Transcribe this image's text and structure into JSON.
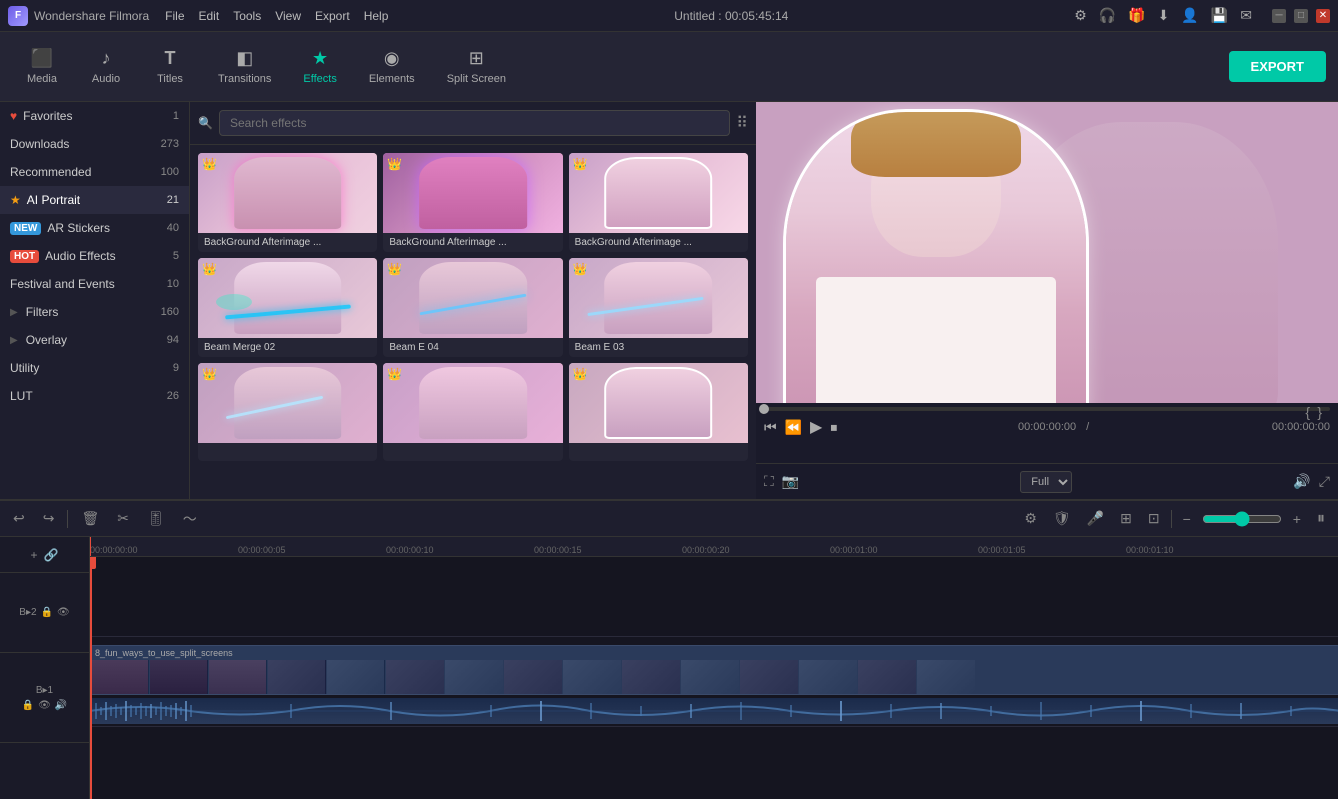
{
  "app": {
    "name": "Wondershare Filmora",
    "title": "Untitled : 00:05:45:14"
  },
  "titlebar": {
    "menus": [
      "File",
      "Edit",
      "Tools",
      "View",
      "Export",
      "Help"
    ],
    "win_controls": [
      "─",
      "□",
      "✕"
    ]
  },
  "toolbar": {
    "items": [
      {
        "id": "media",
        "label": "Media",
        "icon": "⬛"
      },
      {
        "id": "audio",
        "label": "Audio",
        "icon": "♪"
      },
      {
        "id": "titles",
        "label": "Titles",
        "icon": "T"
      },
      {
        "id": "transitions",
        "label": "Transitions",
        "icon": "◧"
      },
      {
        "id": "effects",
        "label": "Effects",
        "icon": "★"
      },
      {
        "id": "elements",
        "label": "Elements",
        "icon": "◉"
      },
      {
        "id": "splitscreen",
        "label": "Split Screen",
        "icon": "⊞"
      }
    ],
    "export_label": "EXPORT"
  },
  "sidebar": {
    "items": [
      {
        "id": "favorites",
        "label": "Favorites",
        "count": "1",
        "icon": "heart",
        "badge": null
      },
      {
        "id": "downloads",
        "label": "Downloads",
        "count": "273",
        "icon": null,
        "badge": null
      },
      {
        "id": "recommended",
        "label": "Recommended",
        "count": "100",
        "icon": null,
        "badge": null
      },
      {
        "id": "ai-portrait",
        "label": "AI Portrait",
        "count": "21",
        "icon": "star",
        "badge": null
      },
      {
        "id": "ar-stickers",
        "label": "AR Stickers",
        "count": "40",
        "icon": null,
        "badge": "NEW"
      },
      {
        "id": "audio-effects",
        "label": "Audio Effects",
        "count": "5",
        "icon": null,
        "badge": "HOT"
      },
      {
        "id": "festival-events",
        "label": "Festival and Events",
        "count": "10",
        "icon": null,
        "badge": null
      },
      {
        "id": "filters",
        "label": "Filters",
        "count": "160",
        "icon": "arrow",
        "badge": null
      },
      {
        "id": "overlay",
        "label": "Overlay",
        "count": "94",
        "icon": "arrow",
        "badge": null
      },
      {
        "id": "utility",
        "label": "Utility",
        "count": "9",
        "icon": null,
        "badge": null
      },
      {
        "id": "lut",
        "label": "LUT",
        "count": "26",
        "icon": null,
        "badge": null
      }
    ]
  },
  "search": {
    "placeholder": "Search effects",
    "value": ""
  },
  "effects": {
    "items": [
      {
        "id": 1,
        "label": "BackGround Afterimage ..."
      },
      {
        "id": 2,
        "label": "BackGround Afterimage ..."
      },
      {
        "id": 3,
        "label": "BackGround Afterimage ..."
      },
      {
        "id": 4,
        "label": "Beam Merge 02"
      },
      {
        "id": 5,
        "label": "Beam E 04"
      },
      {
        "id": 6,
        "label": "Beam E 03"
      },
      {
        "id": 7,
        "label": ""
      },
      {
        "id": 8,
        "label": ""
      },
      {
        "id": 9,
        "label": ""
      }
    ]
  },
  "preview": {
    "time_current": "00:00:00:00",
    "time_total": "00:00:00:00",
    "quality": "Full",
    "progress": 0
  },
  "timeline": {
    "markers": [
      "00:00:00:00",
      "00:00:00:05",
      "00:00:00:10",
      "00:00:00:15",
      "00:00:00:20",
      "00:00:01:00",
      "00:00:01:05",
      "00:00:01:10"
    ],
    "track1_label": "B▸2",
    "clip_name": "8_fun_ways_to_use_split_screens",
    "zoom_level": "100"
  }
}
